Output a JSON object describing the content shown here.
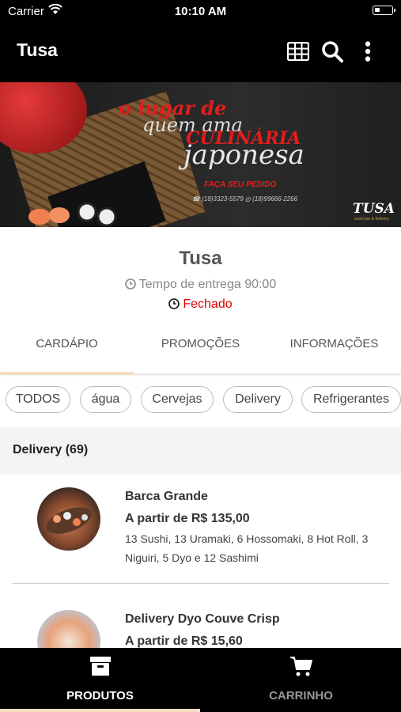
{
  "status_bar": {
    "carrier": "Carrier",
    "time": "10:10 AM"
  },
  "app_bar": {
    "title": "Tusa",
    "icons": [
      "grid-icon",
      "search-icon",
      "more-vertical-icon"
    ]
  },
  "banner": {
    "slogan_line1": "o lugar de",
    "slogan_line2": "quem ama",
    "slogan_line3": "CULINÁRIA",
    "slogan_line4": "japonesa",
    "order_text": "FAÇA SEU PEDIDO",
    "phone1": "(18)3323-5579",
    "phone2": "(18)99666-2266",
    "brand": "TUSA",
    "brand_sub": "sushi bar & delivery"
  },
  "restaurant": {
    "name": "Tusa",
    "delivery_time": "Tempo de entrega 90:00",
    "status": "Fechado"
  },
  "tabs": {
    "active": "CARDÁPIO",
    "items": [
      "CARDÁPIO",
      "PROMOÇÕES",
      "INFORMAÇÕES"
    ]
  },
  "chips": [
    "TODOS",
    "água",
    "Cervejas",
    "Delivery",
    "Refrigerantes"
  ],
  "section": {
    "label": "Delivery (69)"
  },
  "products": [
    {
      "name": "Barca Grande",
      "price": "A partir de R$ 135,00",
      "description": "13 Sushi, 13 Uramaki, 6 Hossomaki, 8 Hot Roll, 3 Niguiri, 5 Dyo e 12 Sashimi"
    },
    {
      "name": "Delivery Dyo Couve Crisp",
      "price": "A partir de R$ 15,60",
      "description": ""
    }
  ],
  "bottom_nav": {
    "active": "PRODUTOS",
    "items": [
      "PRODUTOS",
      "CARRINHO"
    ]
  },
  "colors": {
    "bar": "#000000",
    "accent": "#f5dfc4",
    "closed": "#dd0000"
  }
}
